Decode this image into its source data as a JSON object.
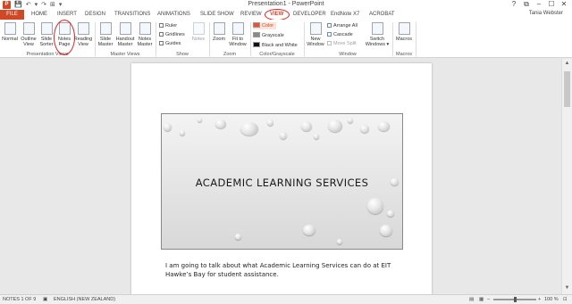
{
  "window": {
    "title": "Presentation1 - PowerPoint",
    "logo_text": "P",
    "qat": {
      "save": "💾",
      "undo": "↶",
      "undo_drop": "▾",
      "redo": "↷",
      "start": "⊞",
      "customize": "▾"
    },
    "controls": {
      "help": "?",
      "ribbon_options": "⧉",
      "minimize": "–",
      "maximize": "☐",
      "close": "✕"
    }
  },
  "user_name": "Tania Webster",
  "tabs": [
    "FILE",
    "HOME",
    "INSERT",
    "DESIGN",
    "TRANSITIONS",
    "ANIMATIONS",
    "SLIDE SHOW",
    "REVIEW",
    "VIEW",
    "DEVELOPER",
    "EndNote X7",
    "ACROBAT"
  ],
  "active_tab": "VIEW",
  "ribbon": {
    "presentation_views": {
      "label": "Presentation Views",
      "buttons": [
        {
          "line1": "Normal",
          "line2": ""
        },
        {
          "line1": "Outline",
          "line2": "View"
        },
        {
          "line1": "Slide",
          "line2": "Sorter"
        },
        {
          "line1": "Notes",
          "line2": "Page"
        },
        {
          "line1": "Reading",
          "line2": "View"
        }
      ]
    },
    "master_views": {
      "label": "Master Views",
      "buttons": [
        {
          "line1": "Slide",
          "line2": "Master"
        },
        {
          "line1": "Handout",
          "line2": "Master"
        },
        {
          "line1": "Notes",
          "line2": "Master"
        }
      ]
    },
    "show": {
      "label": "Show",
      "items": [
        {
          "label": "Ruler",
          "checked": false
        },
        {
          "label": "Gridlines",
          "checked": false
        },
        {
          "label": "Guides",
          "checked": false
        }
      ],
      "notes_button": "Notes"
    },
    "zoom": {
      "label": "Zoom",
      "buttons": [
        {
          "line1": "Zoom",
          "line2": ""
        },
        {
          "line1": "Fit to",
          "line2": "Window"
        }
      ]
    },
    "color_grayscale": {
      "label": "Color/Grayscale",
      "items": [
        {
          "label": "Color",
          "swatch": "#e8523a"
        },
        {
          "label": "Grayscale",
          "swatch": "#8a8a8a"
        },
        {
          "label": "Black and White",
          "swatch": "#111111"
        }
      ]
    },
    "window": {
      "label": "Window",
      "new_window": {
        "line1": "New",
        "line2": "Window"
      },
      "items": [
        "Arrange All",
        "Cascade",
        "Move Split"
      ],
      "switch_windows": {
        "line1": "Switch",
        "line2": "Windows ▾"
      }
    },
    "macros": {
      "label": "Macros",
      "button": "Macros"
    }
  },
  "slide": {
    "title": "ACADEMIC LEARNING SERVICES"
  },
  "notes_text": "I am going to talk about what Academic Learning Services can do at EIT Hawke’s Bay for student assistance.",
  "status": {
    "slide_info": "NOTES 1 OF 9",
    "language": "ENGLISH (NEW ZEALAND)",
    "zoom_level": "100 %",
    "zoom_minus": "–",
    "zoom_plus": "+"
  },
  "scrollbar": {
    "up": "▲",
    "down": "▼"
  }
}
